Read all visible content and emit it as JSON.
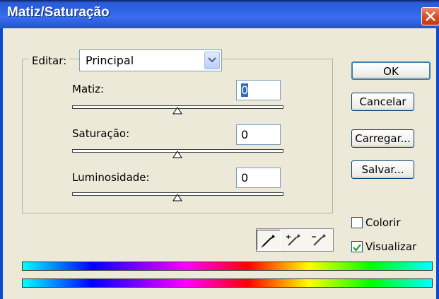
{
  "window": {
    "title": "Matiz/Saturação"
  },
  "edit": {
    "label": "Editar:",
    "value": "Principal"
  },
  "sliders": [
    {
      "label": "Matiz:",
      "value": "0"
    },
    {
      "label": "Saturação:",
      "value": "0"
    },
    {
      "label": "Luminosidade:",
      "value": "0"
    }
  ],
  "buttons": {
    "ok": "OK",
    "cancel": "Cancelar",
    "load": "Carregar...",
    "save": "Salvar..."
  },
  "checkboxes": {
    "colorize": {
      "label": "Colorir",
      "checked": false
    },
    "preview": {
      "label": "Visualizar",
      "checked": true
    }
  },
  "icons": {
    "close": "close-icon",
    "dropdown": "chevron-down-icon",
    "eyedropper": "eyedropper-icon",
    "eyedropper_add": "eyedropper-plus-icon",
    "eyedropper_subtract": "eyedropper-minus-icon"
  }
}
